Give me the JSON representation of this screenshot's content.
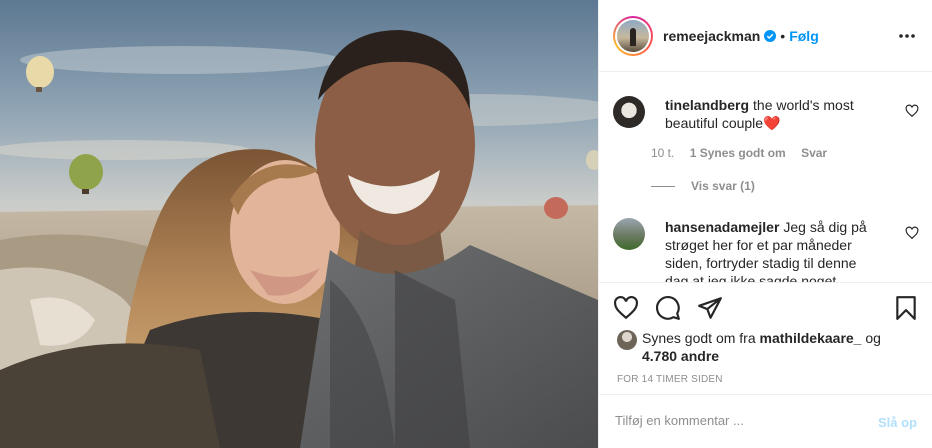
{
  "post": {
    "photo_alt": "",
    "author": {
      "username": "remeejackman",
      "verified": true,
      "separator": "•",
      "follow_label": "Følg"
    },
    "comments": [
      {
        "username": "tinelandberg",
        "text": "the world's most beautiful couple❤️",
        "age": "10 t.",
        "likes": "1 Synes godt om",
        "reply_label": "Svar",
        "view_replies": "Vis svar (1)"
      },
      {
        "username": "hansenadamejler",
        "text": "Jeg så dig på strøget her for et par måneder siden, fortryder stadig til denne dag at jeg ikke sagde noget"
      }
    ],
    "likes": {
      "prefix": "Synes godt om fra",
      "user": "mathildekaare_",
      "conj": "og",
      "count": "4.780 andre"
    },
    "timestamp": "FOR 14 TIMER SIDEN",
    "add_comment": {
      "placeholder": "Tilføj en kommentar ...",
      "post_label": "Slå op"
    }
  },
  "icons": {
    "more": "more-horizontal-icon",
    "like": "heart-icon",
    "comment": "comment-bubble-icon",
    "share": "paper-plane-icon",
    "save": "bookmark-icon",
    "verified": "verified-badge-icon"
  },
  "colors": {
    "accent": "#0095f6",
    "post_button_disabled": "#b2dffc",
    "muted": "#8e8e8e",
    "text": "#262626",
    "heart_red": "#e0121c"
  }
}
